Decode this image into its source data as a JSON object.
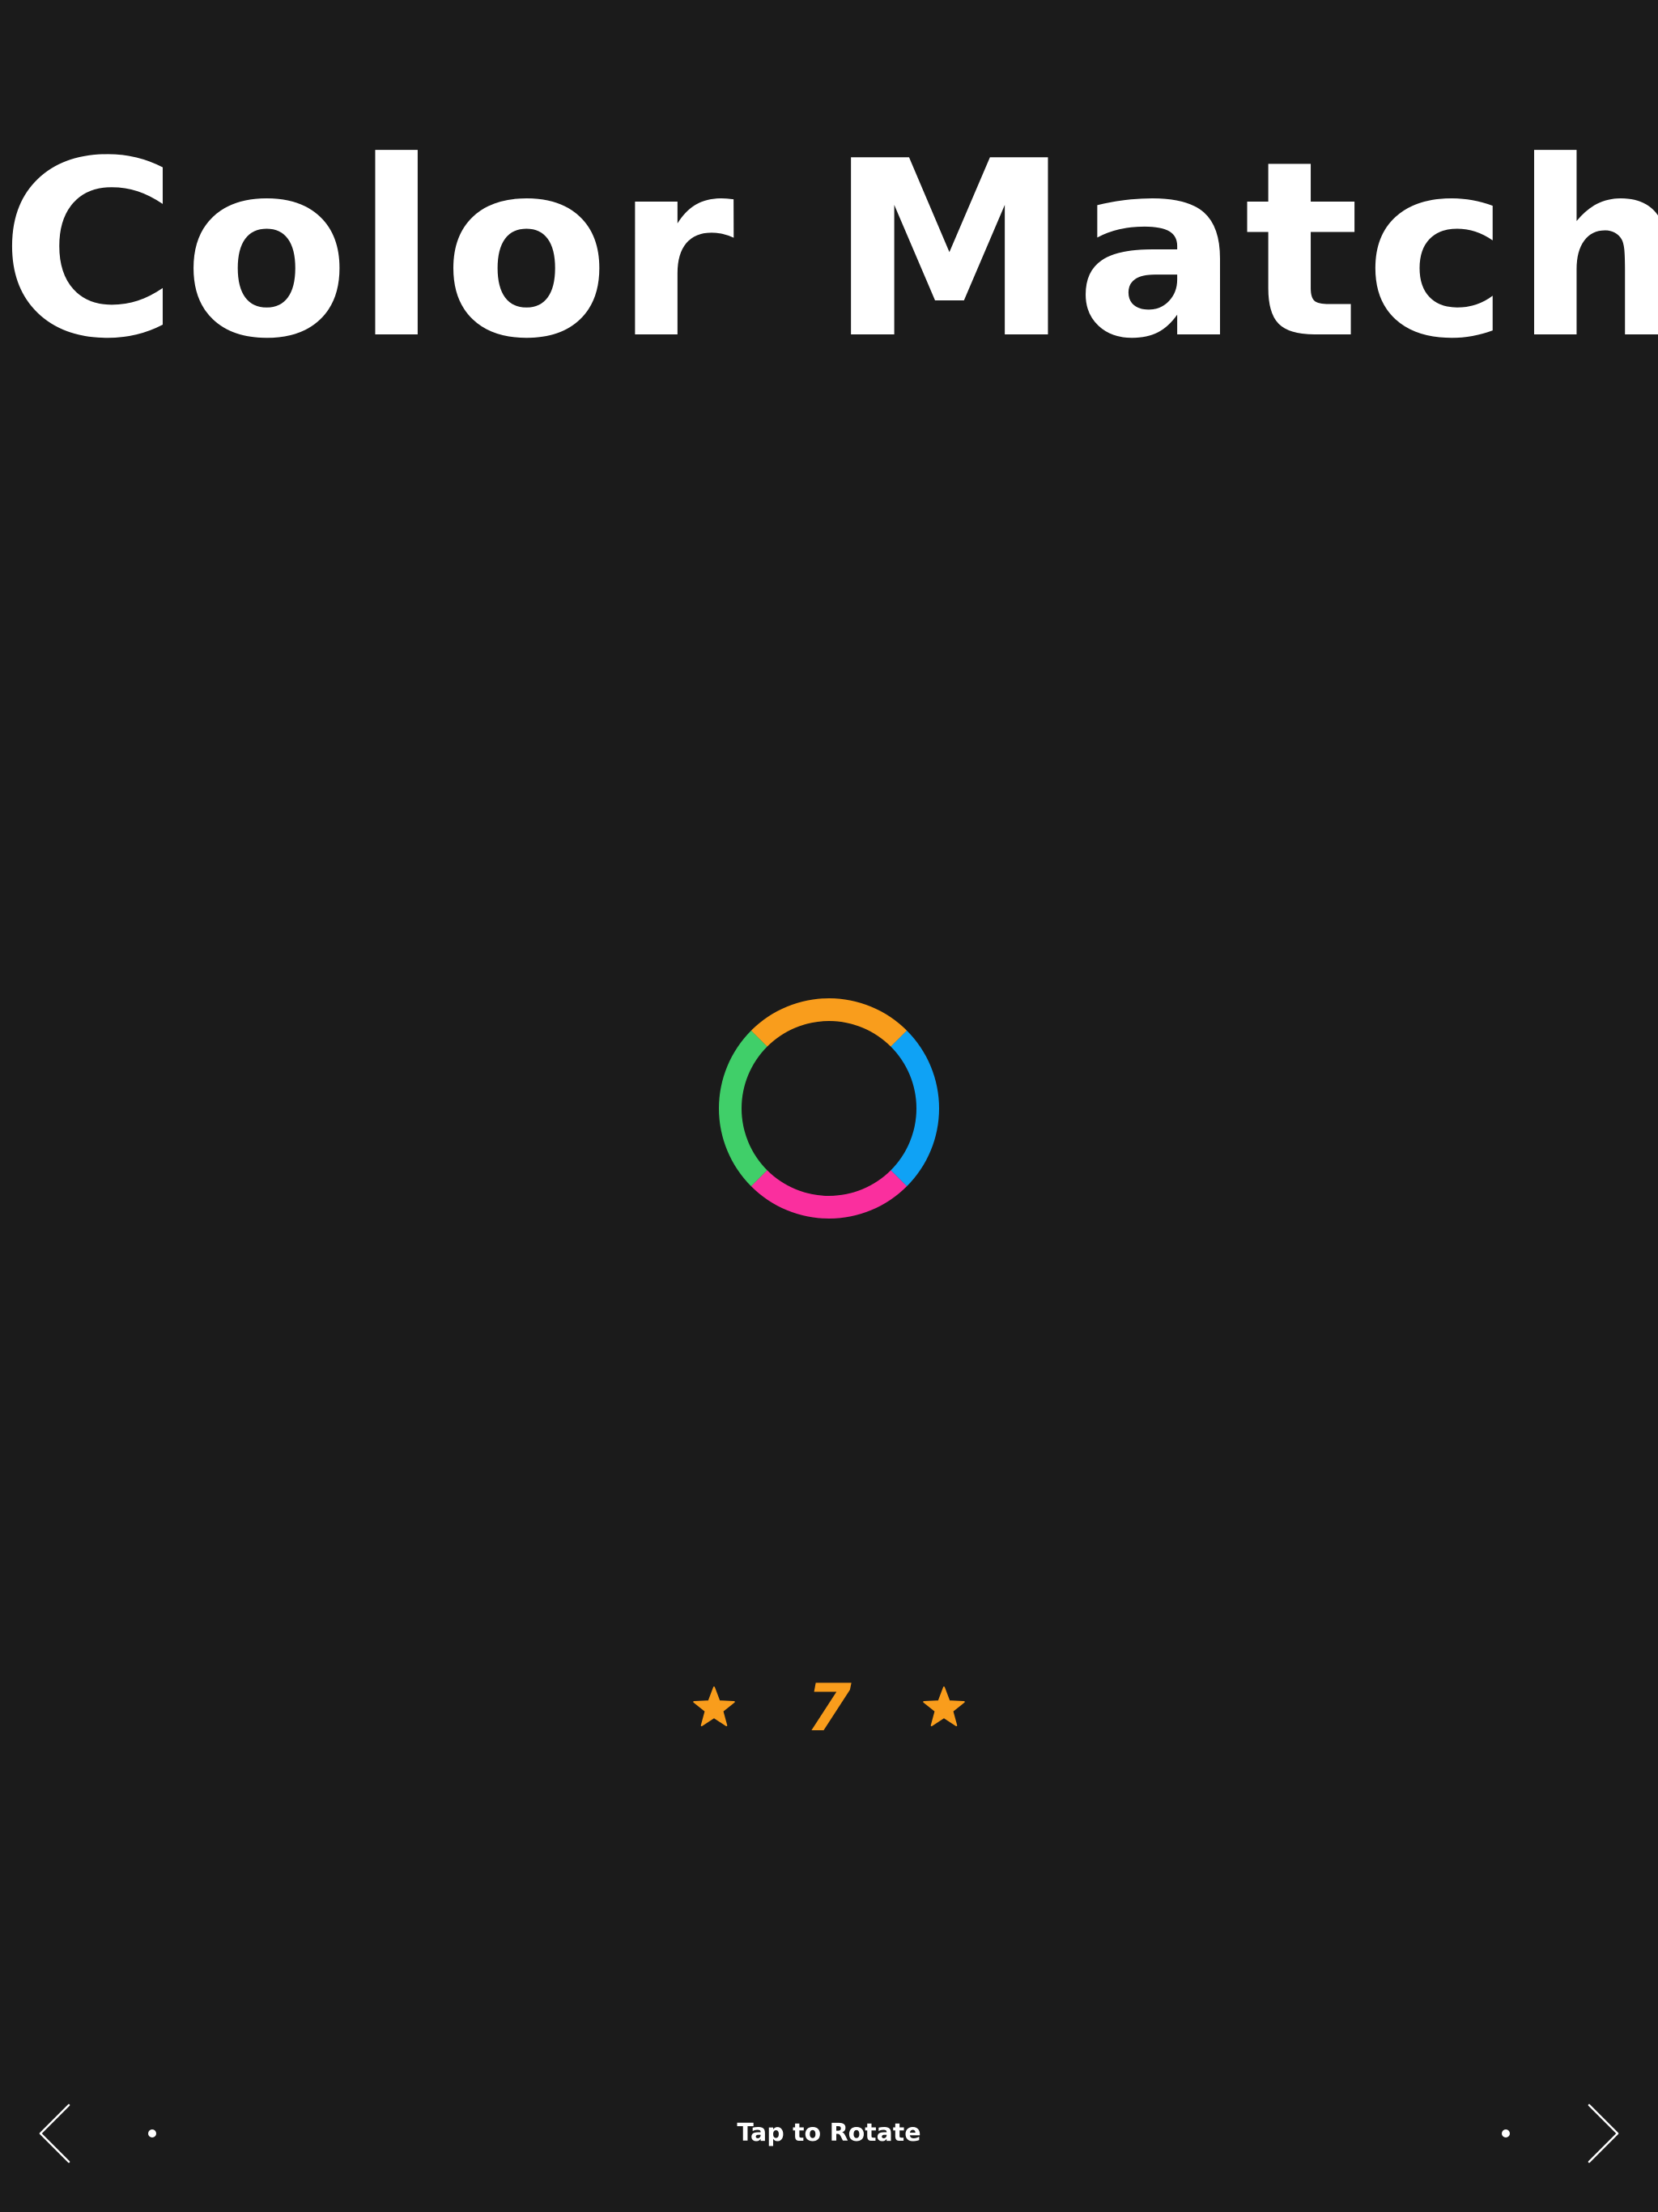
{
  "title": "Color Match",
  "ring": {
    "segments": [
      {
        "name": "top",
        "color": "#f99d1c"
      },
      {
        "name": "right",
        "color": "#0fa2f5"
      },
      {
        "name": "bottom",
        "color": "#fa2f9e"
      },
      {
        "name": "left",
        "color": "#40cf69"
      }
    ]
  },
  "score": {
    "value": "7",
    "accent_color": "#f99d1c",
    "left_icon": "star-icon",
    "right_icon": "star-icon"
  },
  "footer": {
    "hint": "Tap to Rotate",
    "prev_icon": "chevron-left-icon",
    "next_icon": "chevron-right-icon"
  },
  "colors": {
    "background": "#1b1b1b",
    "text": "#ffffff"
  }
}
